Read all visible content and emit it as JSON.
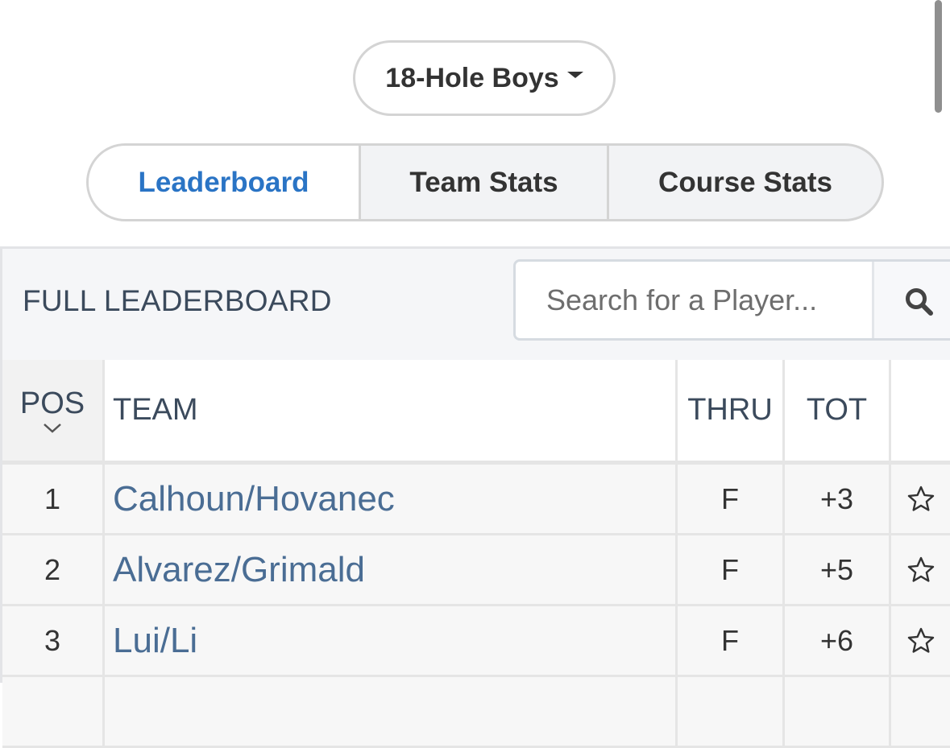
{
  "division": {
    "label": "18-Hole Boys"
  },
  "tabs": [
    {
      "label": "Leaderboard",
      "active": true
    },
    {
      "label": "Team Stats"
    },
    {
      "label": "Course Stats"
    }
  ],
  "leaderboard": {
    "title": "FULL LEADERBOARD",
    "search": {
      "placeholder": "Search for a Player..."
    },
    "columns": {
      "pos": "POS",
      "team": "TEAM",
      "thru": "THRU",
      "tot": "TOT"
    },
    "rows": [
      {
        "pos": "1",
        "team": "Calhoun/Hovanec",
        "thru": "F",
        "tot": "+3"
      },
      {
        "pos": "2",
        "team": "Alvarez/Grimald",
        "thru": "F",
        "tot": "+5"
      },
      {
        "pos": "3",
        "team": "Lui/Li",
        "thru": "F",
        "tot": "+6"
      }
    ]
  },
  "colors": {
    "accent": "#2a74c5",
    "team_link": "#4a6d94"
  }
}
